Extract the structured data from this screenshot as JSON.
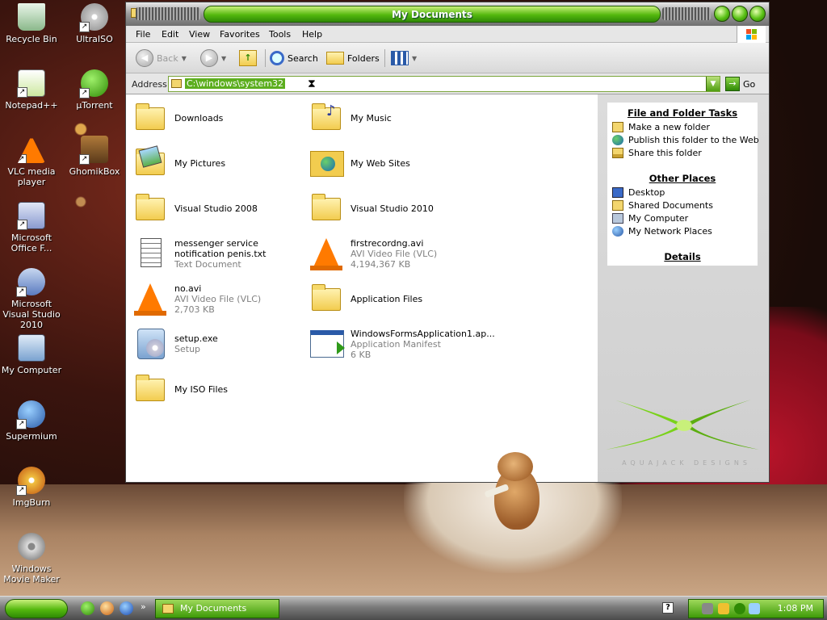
{
  "desktop": {
    "icons": [
      {
        "label": "Recycle Bin"
      },
      {
        "label": "UltraISO"
      },
      {
        "label": "Notepad++"
      },
      {
        "label": "µTorrent"
      },
      {
        "label": "VLC media player"
      },
      {
        "label": "GhomikBox"
      },
      {
        "label": "Microsoft Office F..."
      },
      {
        "label": "Microsoft Visual Studio 2010"
      },
      {
        "label": "My Computer"
      },
      {
        "label": "Supermium"
      },
      {
        "label": "ImgBurn"
      },
      {
        "label": "Windows Movie Maker"
      }
    ]
  },
  "window": {
    "title": "My Documents",
    "menu": [
      "File",
      "Edit",
      "View",
      "Favorites",
      "Tools",
      "Help"
    ],
    "toolbar": {
      "back": "Back",
      "search": "Search",
      "folders": "Folders"
    },
    "address": {
      "label": "Address",
      "value": "C:\\windows\\system32",
      "go": "Go"
    }
  },
  "files": [
    {
      "name": "Downloads",
      "type": "",
      "size": "",
      "icon": "folder-icon"
    },
    {
      "name": "My Music",
      "type": "",
      "size": "",
      "icon": "music-folder-icon"
    },
    {
      "name": "My Pictures",
      "type": "",
      "size": "",
      "icon": "pictures-folder-icon"
    },
    {
      "name": "My Web Sites",
      "type": "",
      "size": "",
      "icon": "web-folder-icon"
    },
    {
      "name": "Visual Studio 2008",
      "type": "",
      "size": "",
      "icon": "folder-icon"
    },
    {
      "name": "Visual Studio 2010",
      "type": "",
      "size": "",
      "icon": "folder-icon"
    },
    {
      "name": "messenger service notification penis.txt",
      "type": "Text Document",
      "size": "",
      "icon": "text-document-icon"
    },
    {
      "name": "firstrecordng.avi",
      "type": "AVI Video File (VLC)",
      "size": "4,194,367 KB",
      "icon": "vlc-cone-icon"
    },
    {
      "name": "no.avi",
      "type": "AVI Video File (VLC)",
      "size": "2,703 KB",
      "icon": "vlc-cone-icon"
    },
    {
      "name": "Application Files",
      "type": "",
      "size": "",
      "icon": "folder-icon"
    },
    {
      "name": "setup.exe",
      "type": "Setup",
      "size": "",
      "icon": "setup-icon"
    },
    {
      "name": "WindowsFormsApplication1.ap...",
      "type": "Application Manifest",
      "size": "6 KB",
      "icon": "manifest-icon"
    },
    {
      "name": "My ISO Files",
      "type": "",
      "size": "",
      "icon": "folder-icon"
    }
  ],
  "taskpane": {
    "file_tasks_title": "File and Folder Tasks",
    "file_tasks": [
      "Make a new folder",
      "Publish this folder to the Web",
      "Share this folder"
    ],
    "other_places_title": "Other Places",
    "other_places": [
      "Desktop",
      "Shared Documents",
      "My Computer",
      "My Network Places"
    ],
    "details_title": "Details",
    "watermark": "AQUAJACK DESIGNS"
  },
  "taskbar": {
    "task_button": "My Documents",
    "clock": "1:08 PM",
    "quicklaunch_more": "»",
    "help_glyph": "?"
  },
  "colors": {
    "accent": "#54b80e",
    "accent_dark": "#2f8a05"
  }
}
